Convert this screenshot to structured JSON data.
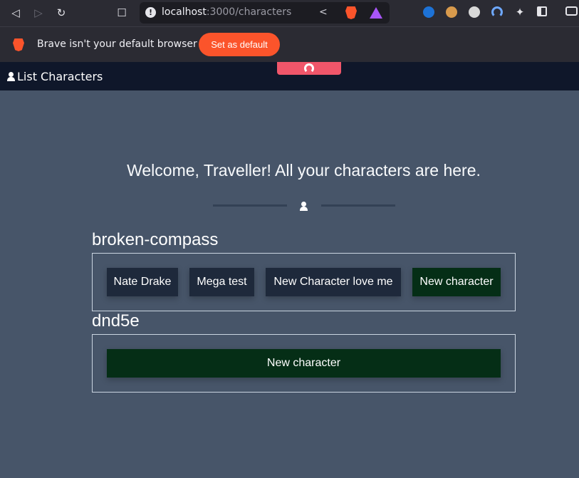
{
  "browser": {
    "url_host": "localhost",
    "url_path": ":3000/characters"
  },
  "banner": {
    "message": "Brave isn't your default browser",
    "button_label": "Set as default"
  },
  "app_nav": {
    "title": "List Characters"
  },
  "main": {
    "welcome": "Welcome, Traveller! All your characters are here."
  },
  "groups": [
    {
      "name": "broken-compass",
      "characters": [
        "Nate Drake",
        "Mega test",
        "New Character love me"
      ],
      "new_label": "New character"
    },
    {
      "name": "dnd5e",
      "characters": [],
      "new_label": "New character"
    }
  ],
  "colors": {
    "page_bg": "#475569",
    "nav_bg": "#0f172a",
    "char_button_bg": "#1e293b",
    "new_button_bg": "#052e16",
    "brave_orange": "#fb542b"
  },
  "icons": {
    "back": "back-icon",
    "forward": "forward-icon",
    "reload": "reload-icon",
    "bookmark": "bookmark-icon",
    "user": "user-icon"
  }
}
